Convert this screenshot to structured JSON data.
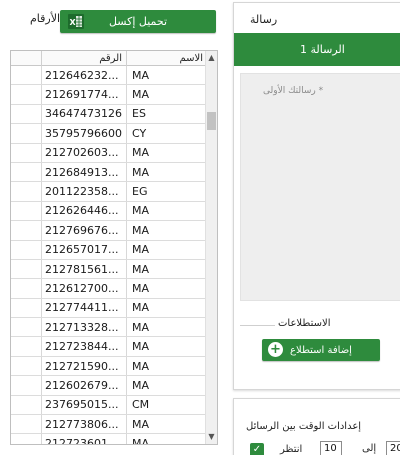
{
  "numbers_panel": {
    "title": "الأرقام",
    "excel_button_label": "تحميل إكسل",
    "columns": {
      "number": "الرقم",
      "name": "الاسم"
    },
    "rows": [
      {
        "number": "212646232...",
        "name": "MA"
      },
      {
        "number": "212691774...",
        "name": "MA"
      },
      {
        "number": "34647473126",
        "name": "ES"
      },
      {
        "number": "35795796600",
        "name": "CY"
      },
      {
        "number": "212702603...",
        "name": "MA"
      },
      {
        "number": "212684913...",
        "name": "MA"
      },
      {
        "number": "201122358...",
        "name": "EG"
      },
      {
        "number": "212626446...",
        "name": "MA"
      },
      {
        "number": "212769676...",
        "name": "MA"
      },
      {
        "number": "212657017...",
        "name": "MA"
      },
      {
        "number": "212781561...",
        "name": "MA"
      },
      {
        "number": "212612700...",
        "name": "MA"
      },
      {
        "number": "212774411...",
        "name": "MA"
      },
      {
        "number": "212713328...",
        "name": "MA"
      },
      {
        "number": "212723844...",
        "name": "MA"
      },
      {
        "number": "212721590...",
        "name": "MA"
      },
      {
        "number": "212602679...",
        "name": "MA"
      },
      {
        "number": "237695015...",
        "name": "CM"
      },
      {
        "number": "212773806...",
        "name": "MA"
      },
      {
        "number": "212723601...",
        "name": "MA"
      }
    ]
  },
  "message_panel": {
    "title": "رسالة",
    "tab_label": "الرسالة 1",
    "placeholder": "رسالتك الأولى *",
    "polls_label": "الاستطلاعات",
    "add_poll_label": "إضافة استطلاع"
  },
  "timing_panel": {
    "title": "إعدادات الوقت بين الرسائل",
    "wait_label": "انتظر",
    "from_value": "10",
    "to_label": "إلى",
    "to_value": "20"
  },
  "colors": {
    "accent": "#2e8b3d"
  }
}
